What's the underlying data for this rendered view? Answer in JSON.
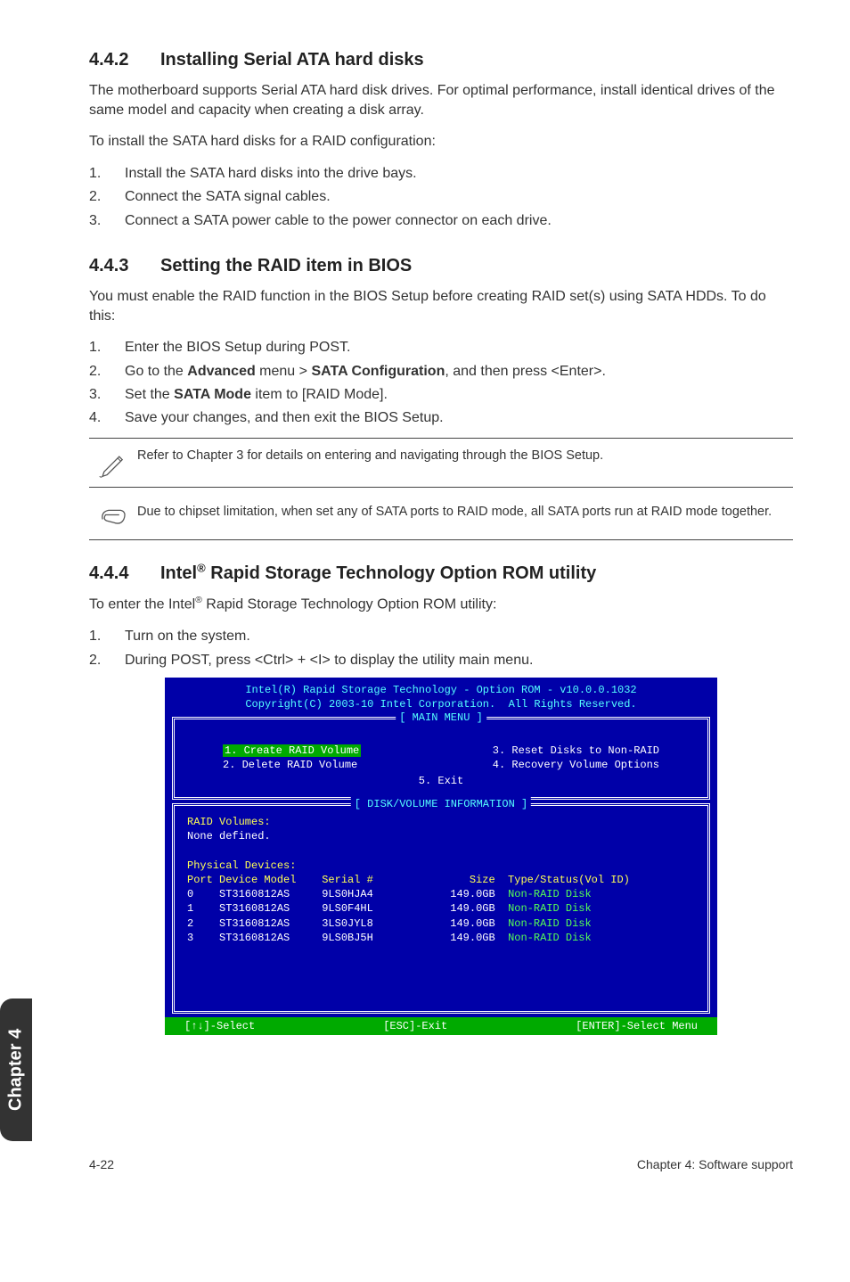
{
  "section442": {
    "num": "4.4.2",
    "title": "Installing Serial ATA hard disks",
    "p1": "The motherboard supports Serial ATA hard disk drives. For optimal performance, install identical drives of the same model and capacity when creating a disk array.",
    "p2": "To install the SATA hard disks for a RAID configuration:",
    "steps": [
      "Install the SATA hard disks into the drive bays.",
      "Connect the SATA signal cables.",
      "Connect a SATA power cable to the power connector on each drive."
    ]
  },
  "section443": {
    "num": "4.4.3",
    "title": "Setting the RAID item in BIOS",
    "p1": "You must enable the RAID function in the BIOS Setup before creating RAID set(s) using SATA HDDs. To do this:",
    "steps": [
      "Enter the BIOS Setup during POST.",
      "Go to the Advanced menu > SATA Configuration, and then press <Enter>.",
      "Set the SATA Mode item to [RAID Mode].",
      "Save your changes, and then exit the BIOS Setup."
    ],
    "step2_pre": "Go to the ",
    "step2_b1": "Advanced",
    "step2_mid": " menu > ",
    "step2_b2": "SATA Configuration",
    "step2_post": ", and then press <Enter>.",
    "step3_pre": "Set the ",
    "step3_b": "SATA Mode",
    "step3_post": " item to [RAID Mode].",
    "note1": "Refer to Chapter 3 for details on entering and navigating through the BIOS Setup.",
    "note2": "Due to chipset limitation, when set any of SATA ports to RAID mode, all SATA ports run at RAID mode together."
  },
  "section444": {
    "num": "4.4.4",
    "title_pre": "Intel",
    "title_post": " Rapid Storage Technology Option ROM utility",
    "p1_pre": "To enter the Intel",
    "p1_post": " Rapid Storage Technology Option ROM utility:",
    "steps": [
      "Turn on the system.",
      "During POST, press <Ctrl> + <I> to display the utility main menu."
    ]
  },
  "bios": {
    "hdr1": "Intel(R) Rapid Storage Technology - Option ROM - v10.0.0.1032",
    "hdr2": "Copyright(C) 2003-10 Intel Corporation.  All Rights Reserved.",
    "main_title": "[ MAIN MENU ]",
    "menu": {
      "i1": "1. Create RAID Volume",
      "i2": "2. Delete RAID Volume",
      "i3": "3. Reset Disks to Non-RAID",
      "i4": "4. Recovery Volume Options",
      "i5": "5. Exit"
    },
    "disk_title": "[ DISK/VOLUME INFORMATION ]",
    "raid_vol_label": "RAID Volumes:",
    "none_defined": "None defined.",
    "phys_label": "Physical Devices:",
    "cols": {
      "port": "Port",
      "device": "Device Model",
      "serial": "Serial #",
      "size": "Size",
      "type": "Type/Status(Vol ID)"
    },
    "rows": [
      {
        "port": "0",
        "model": "ST3160812AS",
        "serial": "9LS0HJA4",
        "size": "149.0GB",
        "status": "Non-RAID Disk"
      },
      {
        "port": "1",
        "model": "ST3160812AS",
        "serial": "9LS0F4HL",
        "size": "149.0GB",
        "status": "Non-RAID Disk"
      },
      {
        "port": "2",
        "model": "ST3160812AS",
        "serial": "3LS0JYL8",
        "size": "149.0GB",
        "status": "Non-RAID Disk"
      },
      {
        "port": "3",
        "model": "ST3160812AS",
        "serial": "9LS0BJ5H",
        "size": "149.0GB",
        "status": "Non-RAID Disk"
      }
    ],
    "footer": {
      "left": "[↑↓]-Select",
      "mid": "[ESC]-Exit",
      "right": "[ENTER]-Select Menu"
    }
  },
  "sidetab": "Chapter 4",
  "footer": {
    "left": "4-22",
    "right": "Chapter 4: Software support"
  }
}
